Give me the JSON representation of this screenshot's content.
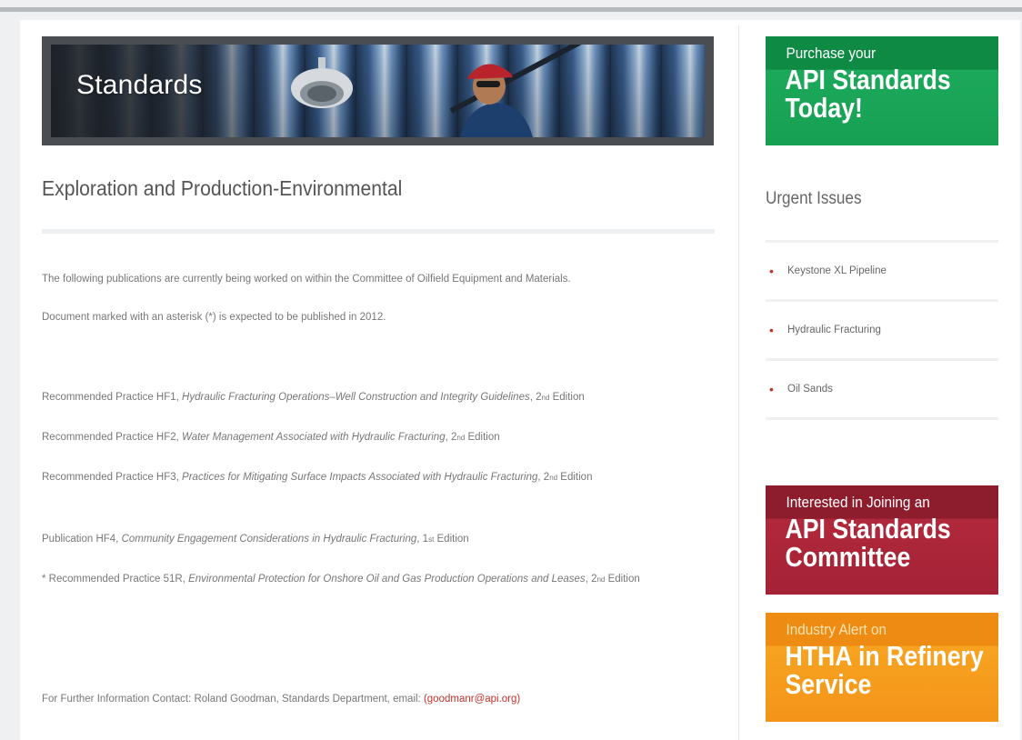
{
  "banner": {
    "title": "Standards"
  },
  "page": {
    "title": "Exploration and Production-Environmental"
  },
  "intro": [
    "The following publications are currently being worked on within the Committee of Oilfield Equipment and Materials.",
    "Document marked with an asterisk (*) is expected to be published in 2012."
  ],
  "publications": [
    {
      "prefix": "Recommended Practice HF1, ",
      "title": "Hydraulic Fracturing Operations–Well Construction and Integrity Guidelines",
      "sep": ", ",
      "num": "2",
      "ord": "nd",
      "suffix": " Edition"
    },
    {
      "prefix": "Recommended Practice HF2, ",
      "title": "Water Management Associated with Hydraulic Fracturing",
      "sep": ", ",
      "num": "2",
      "ord": "nd",
      "suffix": " Edition"
    },
    {
      "prefix": "Recommended Practice HF3, ",
      "title": "Practices for Mitigating Surface Impacts Associated with Hydraulic Fracturing",
      "sep": ", ",
      "num": "2",
      "ord": "nd",
      "suffix": " Edition"
    },
    {
      "prefix": "Publication HF4, ",
      "title": "Community Engagement Considerations in Hydraulic Fracturing",
      "sep": ", ",
      "num": "1",
      "ord": "st",
      "suffix": " Edition"
    },
    {
      "prefix": "* Recommended Practice 51R, ",
      "title": "Environmental Protection for Onshore Oil and Gas Production Operations and Leases",
      "sep": ", ",
      "num": "2",
      "ord": "nd",
      "suffix": " Edition"
    }
  ],
  "contact": {
    "text": "For Further Information Contact: Roland Goodman, Standards Department, email: ",
    "email": "(goodmanr@api.org)"
  },
  "sidebar": {
    "promo_purchase": {
      "top": "Purchase your",
      "line1": "API Standards",
      "line2": "Today!"
    },
    "urgent_title": "Urgent Issues",
    "issues": [
      "Keystone XL Pipeline",
      "Hydraulic Fracturing",
      "Oil Sands"
    ],
    "promo_join": {
      "top": "Interested in Joining an",
      "line1": "API Standards",
      "line2": "Committee"
    },
    "promo_alert": {
      "top": "Industry Alert on",
      "line1": "HTHA in Refinery",
      "line2": "Service"
    }
  },
  "colors": {
    "accent_red": "#c0332c",
    "promo_green": "#16a053",
    "promo_red": "#a52236",
    "promo_orange": "#f49419"
  }
}
